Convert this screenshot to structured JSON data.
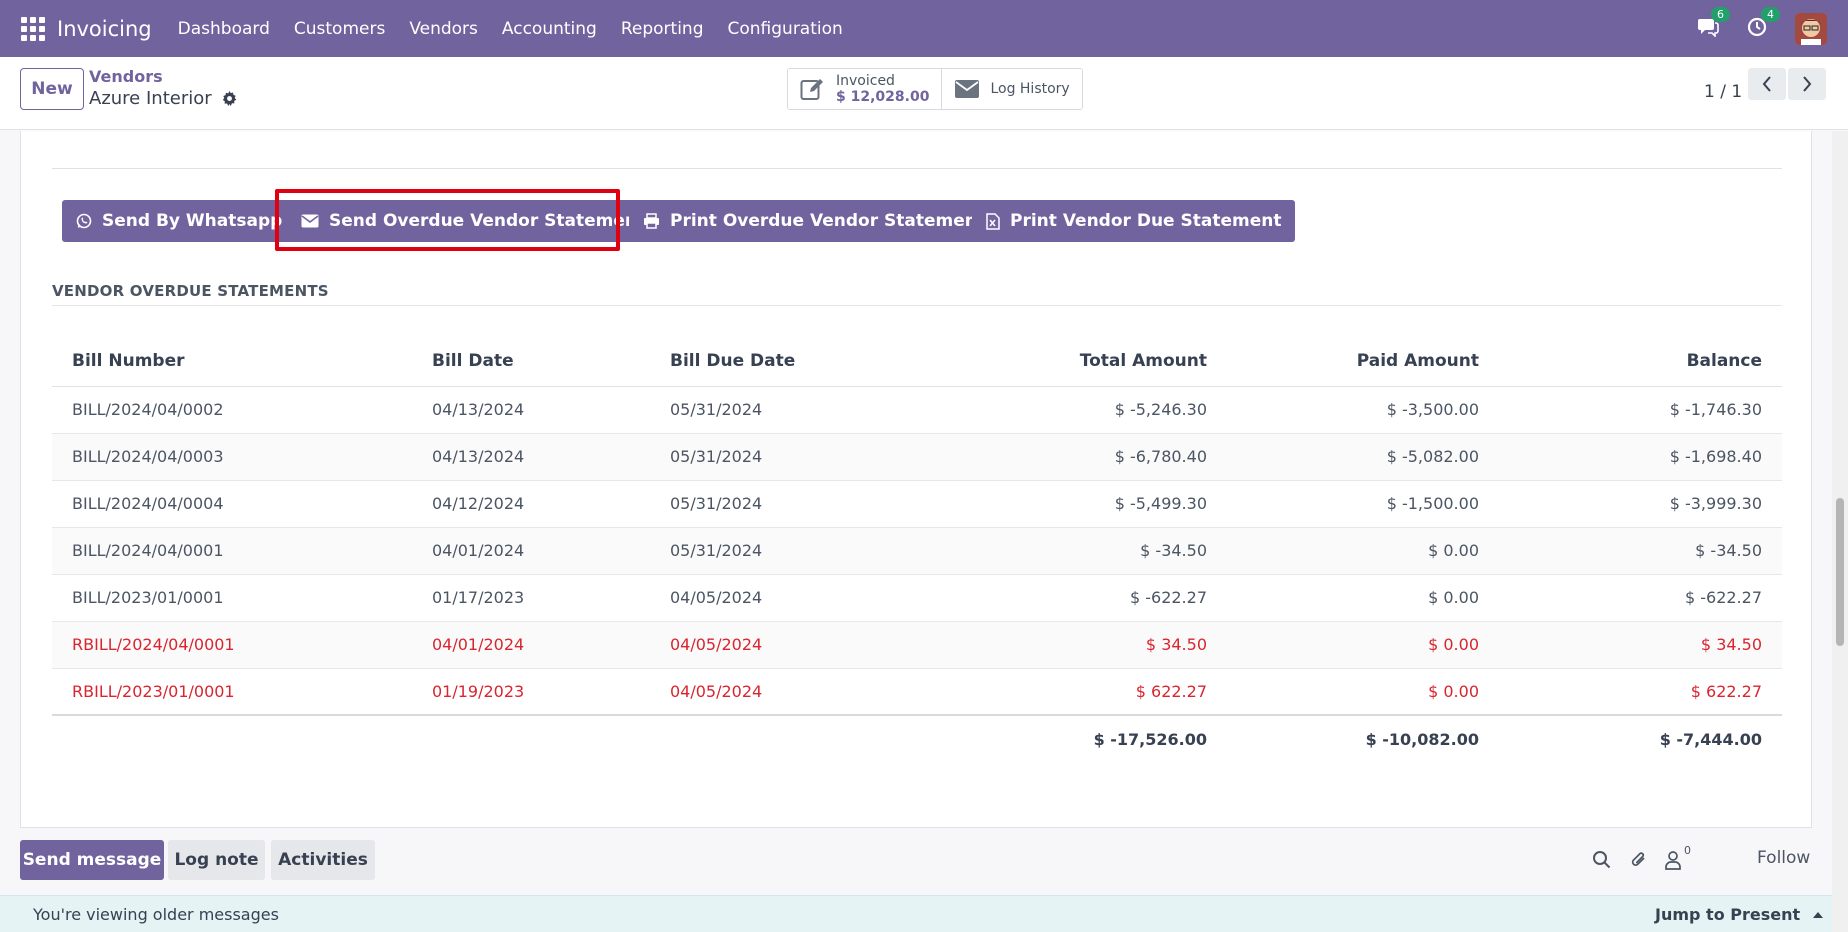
{
  "navbar": {
    "app_name": "Invoicing",
    "menu": [
      "Dashboard",
      "Customers",
      "Vendors",
      "Accounting",
      "Reporting",
      "Configuration"
    ],
    "messages_count": "6",
    "activities_count": "4",
    "accent": "#71639e"
  },
  "control_panel": {
    "new_label": "New",
    "breadcrumb_parent": "Vendors",
    "record_name": "Azure Interior",
    "stat_invoiced_label": "Invoiced",
    "stat_invoiced_value": "$ 12,028.00",
    "stat_log_label": "Log History",
    "pager": "1 / 1"
  },
  "actions": {
    "whatsapp": "Send By Whatsapp",
    "send_overdue": "Send Overdue Vendor Statement",
    "print_overdue": "Print Overdue Vendor Statement",
    "print_due": "Print Vendor Due Statement"
  },
  "section_title": "VENDOR OVERDUE STATEMENTS",
  "table": {
    "headers": [
      "Bill Number",
      "Bill Date",
      "Bill Due Date",
      "Total Amount",
      "Paid Amount",
      "Balance"
    ],
    "rows": [
      [
        "BILL/2024/04/0002",
        "04/13/2024",
        "05/31/2024",
        "$ -5,246.30",
        "$ -3,500.00",
        "$ -1,746.30"
      ],
      [
        "BILL/2024/04/0003",
        "04/13/2024",
        "05/31/2024",
        "$ -6,780.40",
        "$ -5,082.00",
        "$ -1,698.40"
      ],
      [
        "BILL/2024/04/0004",
        "04/12/2024",
        "05/31/2024",
        "$ -5,499.30",
        "$ -1,500.00",
        "$ -3,999.30"
      ],
      [
        "BILL/2024/04/0001",
        "04/01/2024",
        "05/31/2024",
        "$ -34.50",
        "$ 0.00",
        "$ -34.50"
      ],
      [
        "BILL/2023/01/0001",
        "01/17/2023",
        "04/05/2024",
        "$ -622.27",
        "$ 0.00",
        "$ -622.27"
      ],
      [
        "RBILL/2024/04/0001",
        "04/01/2024",
        "04/05/2024",
        "$ 34.50",
        "$ 0.00",
        "$ 34.50"
      ],
      [
        "RBILL/2023/01/0001",
        "01/19/2023",
        "04/05/2024",
        "$ 622.27",
        "$ 0.00",
        "$ 622.27"
      ]
    ],
    "totals": [
      "$ -17,526.00",
      "$ -10,082.00",
      "$ -7,444.00"
    ]
  },
  "chatter": {
    "send_message": "Send message",
    "log_note": "Log note",
    "activities": "Activities",
    "followers_count": "0",
    "follow": "Follow",
    "older_messages": "You're viewing older messages",
    "jump_to_present": "Jump to Present"
  }
}
